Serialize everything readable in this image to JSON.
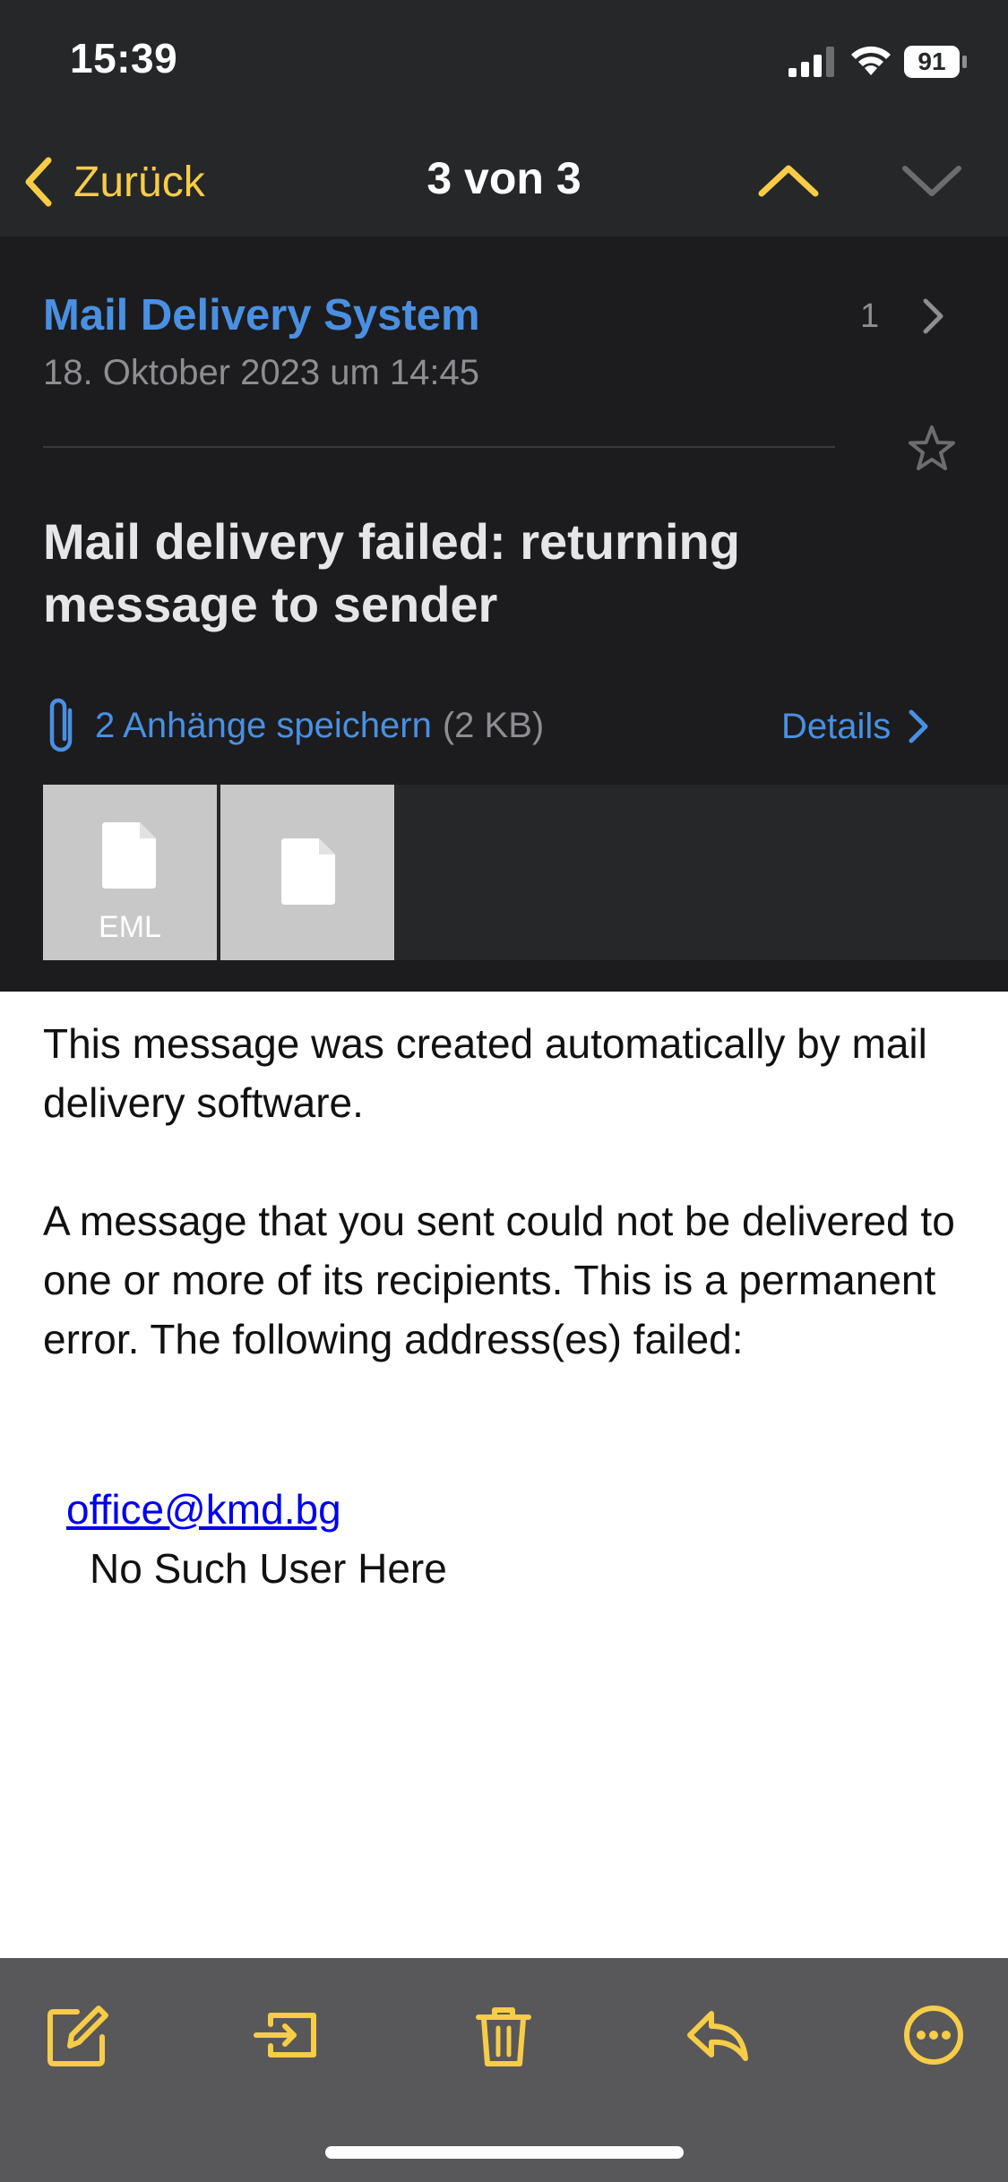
{
  "status": {
    "time": "15:39",
    "battery": "91"
  },
  "nav": {
    "back_label": "Zurück",
    "title": "3 von 3"
  },
  "message": {
    "sender": "Mail Delivery System",
    "date": "18. Oktober 2023 um 14:45",
    "thread_count": "1",
    "subject": "Mail delivery failed: returning message to sender"
  },
  "attachments": {
    "save_label": "2 Anhänge speichern",
    "size": "(2 KB)",
    "details_label": "Details",
    "items": [
      {
        "label": "EML"
      },
      {
        "label": ""
      }
    ]
  },
  "body": {
    "paragraph_1": "This message was created automatically by mail delivery software.",
    "paragraph_2": "A message that you sent could not be delivered to one or more of its recipients. This is a permanent error. The following address(es) failed:",
    "failed_address": "office@kmd.bg",
    "error": "No Such User Here"
  },
  "toolbar": {
    "items": [
      "compose-icon",
      "move-to-folder-icon",
      "trash-icon",
      "reply-icon",
      "more-icon"
    ]
  },
  "colors": {
    "accent": "#f7cc47",
    "link_blue": "#4a90e2",
    "header_bg": "#1c1c1e",
    "nav_bg": "#262729",
    "toolbar_bg": "#58585a"
  }
}
